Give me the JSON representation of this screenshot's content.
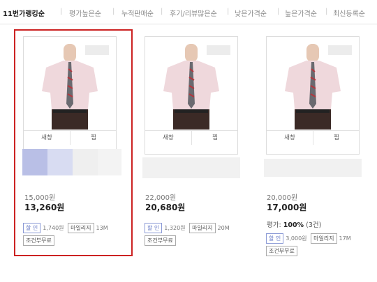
{
  "sort_tabs": [
    {
      "label": "11번가랭킹순",
      "active": true
    },
    {
      "label": "평가높은순",
      "active": false
    },
    {
      "label": "누적판매순",
      "active": false
    },
    {
      "label": "후기/리뷰많은순",
      "active": false
    },
    {
      "label": "낮은가격순",
      "active": false
    },
    {
      "label": "높은가격순",
      "active": false
    },
    {
      "label": "최신등록순",
      "active": false
    }
  ],
  "products": [
    {
      "new_window_label": "새창",
      "wish_label": "찜",
      "price_original": "15,000원",
      "price_sale": "13,260원",
      "discount_chip": "할 인",
      "discount_amount": "1,740원",
      "mileage_chip": "마일리지",
      "mileage_value": "13M",
      "shipping": "조건부무료",
      "selected": true
    },
    {
      "new_window_label": "새창",
      "wish_label": "찜",
      "price_original": "22,000원",
      "price_sale": "20,680원",
      "discount_chip": "할 인",
      "discount_amount": "1,320원",
      "mileage_chip": "마일리지",
      "mileage_value": "20M",
      "shipping": "조건부무료",
      "selected": false
    },
    {
      "new_window_label": "새창",
      "wish_label": "찜",
      "price_original": "20,000원",
      "price_sale": "17,000원",
      "rating_label": "평가:",
      "rating_value": "100%",
      "rating_count": "(3건)",
      "discount_chip": "할 인",
      "discount_amount": "3,000원",
      "mileage_chip": "마일리지",
      "mileage_value": "17M",
      "shipping": "조건부무료",
      "selected": false
    }
  ],
  "colors": {
    "selected_border": "#cc2222",
    "swatch_blue_dark": "#b9bfe6",
    "swatch_blue_light": "#d8dcf2",
    "swatch_gray": "#efefef"
  }
}
